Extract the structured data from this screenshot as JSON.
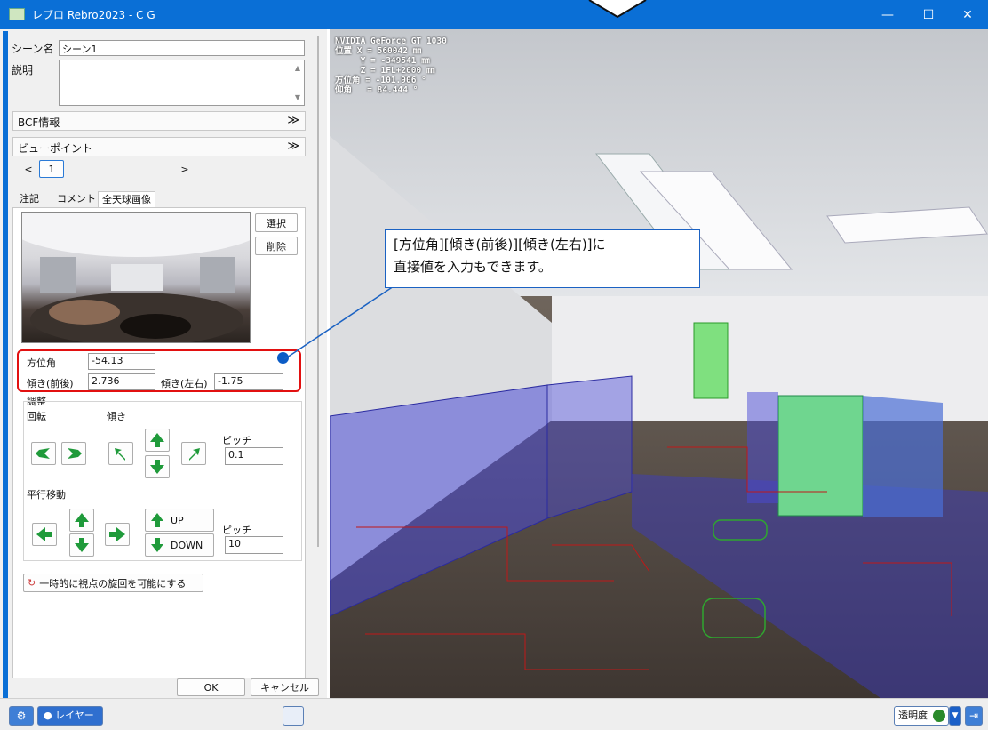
{
  "window": {
    "title": "レブロ Rebro2023 - C G",
    "minimize": "—",
    "maximize": "☐",
    "close": "✕"
  },
  "scene": {
    "name_label": "シーン名",
    "name_value": "シーン1",
    "description_label": "説明",
    "bcf_label": "BCF情報",
    "viewpoint_label": "ビューポイント",
    "viewpoint_prev": "<",
    "viewpoint_index": "1",
    "viewpoint_next": ">"
  },
  "tabs": [
    "注記",
    "コメント",
    "全天球画像"
  ],
  "image_buttons": {
    "select": "選択",
    "delete": "削除"
  },
  "orientation": {
    "azimuth_label": "方位角",
    "azimuth_value": "-54.13",
    "tilt_fb_label": "傾き(前後)",
    "tilt_fb_value": "2.736",
    "tilt_lr_label": "傾き(左右)",
    "tilt_lr_value": "-1.75"
  },
  "adjust": {
    "title": "調整",
    "rotate_label": "回転",
    "tilt_label": "傾き",
    "pitch_label": "ピッチ",
    "pitch_value": "0.1"
  },
  "translate": {
    "title": "平行移動",
    "up_label": "UP",
    "down_label": "DOWN",
    "pitch_label": "ピッチ",
    "pitch_value": "10"
  },
  "rotation_toggle_label": "一時的に視点の旋回を可能にする",
  "dialog_buttons": {
    "ok": "OK",
    "cancel": "キャンセル"
  },
  "viewport": {
    "osd": "NVIDIA GeForce GT 1030\n位置 X = 560042 ㎜\n     Y = -349541 ㎜\n     Z = 1FL+2000 ㎜\n方位角 = -101.906 °\n仰角   = 84.444 °"
  },
  "callout": {
    "line1": "[方位角][傾き(前後)][傾き(左右)]に",
    "line2": "直接値を入力もできます。"
  },
  "statusbar": {
    "layer_label": "レイヤー",
    "transparency_label": "透明度"
  },
  "colors": {
    "titlebar": "#0a6fd6",
    "highlight": "#e21010",
    "arrow_green": "#1f9a3a"
  }
}
